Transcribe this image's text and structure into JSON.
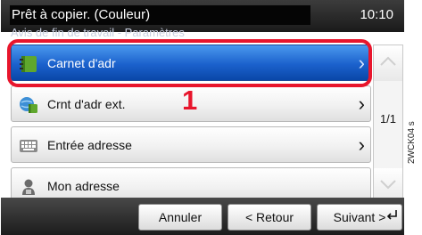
{
  "status": {
    "title": "Prêt à copier. (Couleur)",
    "time": "10:10"
  },
  "subtitle": "Avis de fin de travail - Paramètres",
  "list": {
    "items": [
      {
        "label": "Carnet d'adr",
        "icon": "address-book-icon",
        "selected": true
      },
      {
        "label": "Crnt d'adr ext.",
        "icon": "external-address-book-icon",
        "selected": false
      },
      {
        "label": "Entrée adresse",
        "icon": "keyboard-icon",
        "selected": false
      },
      {
        "label": "Mon adresse",
        "icon": "person-icon",
        "selected": false
      }
    ]
  },
  "annotation": {
    "step_number": "1",
    "color": "#e8152c"
  },
  "scroll": {
    "page_indicator": "1/1"
  },
  "buttons": {
    "cancel": "Annuler",
    "back": "< Retour",
    "next": "Suivant >"
  },
  "watermark": "2WCK04 s"
}
